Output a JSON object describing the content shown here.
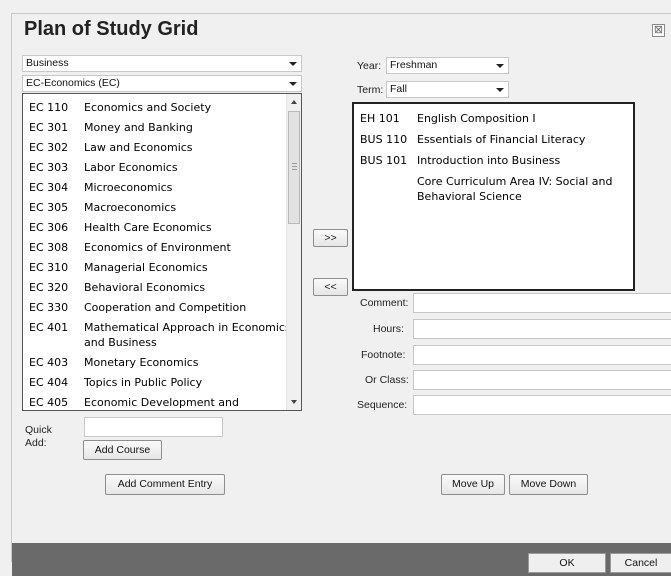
{
  "dialog": {
    "title": "Plan of Study Grid",
    "close_glyph": "⊠"
  },
  "left": {
    "department_select": "Business",
    "subject_select": "EC-Economics (EC)",
    "courses": [
      {
        "code": "EC 110",
        "name": "Economics and Society"
      },
      {
        "code": "EC 301",
        "name": "Money and Banking"
      },
      {
        "code": "EC 302",
        "name": "Law and Economics"
      },
      {
        "code": "EC 303",
        "name": "Labor Economics"
      },
      {
        "code": "EC 304",
        "name": "Microeconomics"
      },
      {
        "code": "EC 305",
        "name": "Macroeconomics"
      },
      {
        "code": "EC 306",
        "name": "Health Care Economics"
      },
      {
        "code": "EC 308",
        "name": "Economics of Environment"
      },
      {
        "code": "EC 310",
        "name": "Managerial Economics"
      },
      {
        "code": "EC 320",
        "name": "Behavioral Economics"
      },
      {
        "code": "EC 330",
        "name": "Cooperation and Competition"
      },
      {
        "code": "EC 401",
        "name": "Mathematical Approach in Economics and Business"
      },
      {
        "code": "EC 403",
        "name": "Monetary Economics"
      },
      {
        "code": "EC 404",
        "name": "Topics in Public Policy"
      },
      {
        "code": "EC 405",
        "name": "Economic Development and"
      }
    ],
    "quick_add_label": "Quick Add:",
    "add_course_label": "Add Course",
    "add_comment_label": "Add Comment Entry"
  },
  "transfer": {
    "add_label": ">>",
    "remove_label": "<<"
  },
  "right": {
    "year_label": "Year:",
    "year_value": "Freshman",
    "term_label": "Term:",
    "term_value": "Fall",
    "plan": [
      {
        "code": "EH 101",
        "name": "English Composition I"
      },
      {
        "code": "BUS 110",
        "name": "Essentials of Financial Literacy"
      },
      {
        "code": "BUS 101",
        "name": "Introduction into Business"
      },
      {
        "code": "",
        "name": "Core Curriculum Area IV: Social and Behavioral Science"
      }
    ],
    "fields": {
      "comment": "Comment:",
      "hours": "Hours:",
      "footnote": "Footnote:",
      "or_class": "Or Class:",
      "sequence": "Sequence:"
    },
    "move_up_label": "Move Up",
    "move_down_label": "Move Down"
  },
  "footer": {
    "ok_label": "OK",
    "cancel_label": "Cancel"
  },
  "colors": {
    "footer_bg": "#6a6a6a",
    "panel_bg": "#f0f0f0"
  }
}
